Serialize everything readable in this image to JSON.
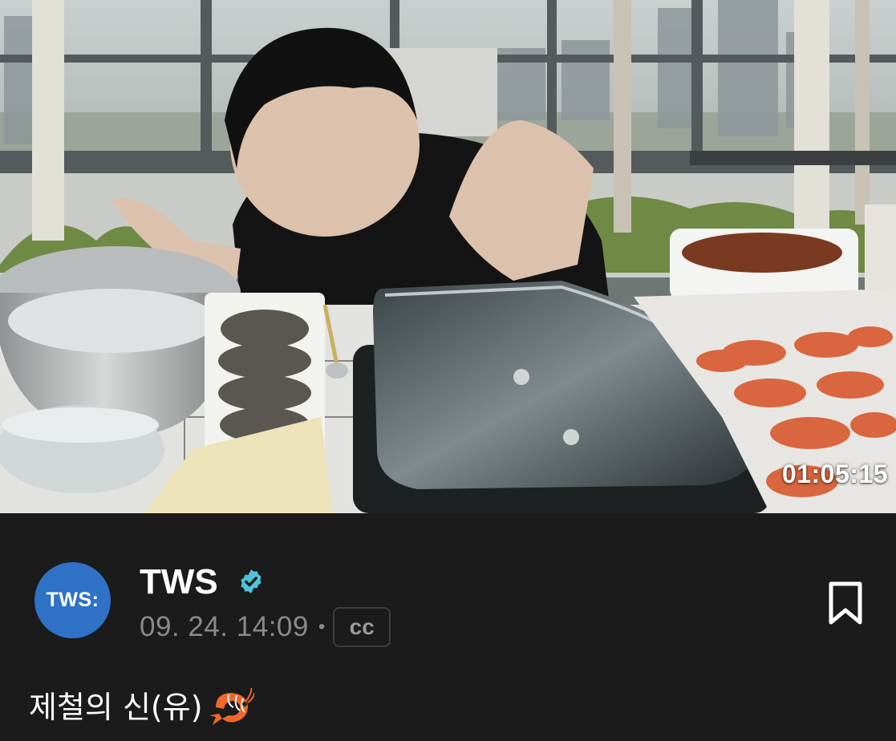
{
  "video": {
    "duration": "01:05:15",
    "thumbnail_description_icon": "video-thumbnail"
  },
  "post": {
    "author": "TWS",
    "avatar_text": "TWS:",
    "verified": true,
    "date": "09. 24. 14:09",
    "separator": "•",
    "cc_label": "cc",
    "caption": "제철의 신(유)",
    "caption_emoji": "shrimp-emoji"
  },
  "icons": {
    "verified": "verified-badge-icon",
    "bookmark": "bookmark-icon"
  },
  "colors": {
    "background": "#1b1b1b",
    "avatar": "#2f72c6",
    "verified": "#4fc3d9",
    "muted_text": "#8a8a8a"
  }
}
